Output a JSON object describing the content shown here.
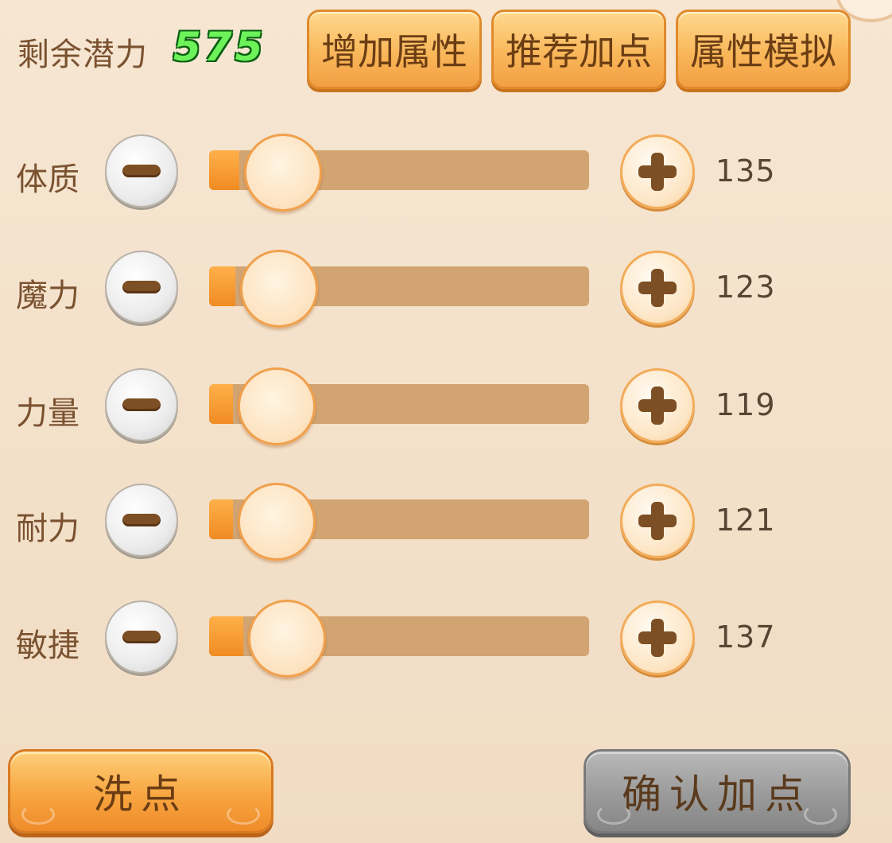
{
  "header": {
    "potential_label": "剩余潜力",
    "potential_value": "575",
    "buttons": {
      "add_attribute": "增加属性",
      "recommend_points": "推荐加点",
      "attribute_simulate": "属性模拟"
    }
  },
  "stats": [
    {
      "label": "体质",
      "value": "135",
      "level": 0.08
    },
    {
      "label": "魔力",
      "value": "123",
      "level": 0.07
    },
    {
      "label": "力量",
      "value": "119",
      "level": 0.06
    },
    {
      "label": "耐力",
      "value": "121",
      "level": 0.06
    },
    {
      "label": "敏捷",
      "value": "137",
      "level": 0.09
    }
  ],
  "footer": {
    "reset_label": "洗点",
    "confirm_label": "确认加点"
  },
  "colors": {
    "potential_green": "#6df25a",
    "orange_button": "#f9b75a",
    "confirm_disabled_gray": "#9a9a9a",
    "text_brown": "#7a5230"
  },
  "icons": {
    "decrease": "minus-icon",
    "increase": "plus-icon"
  }
}
